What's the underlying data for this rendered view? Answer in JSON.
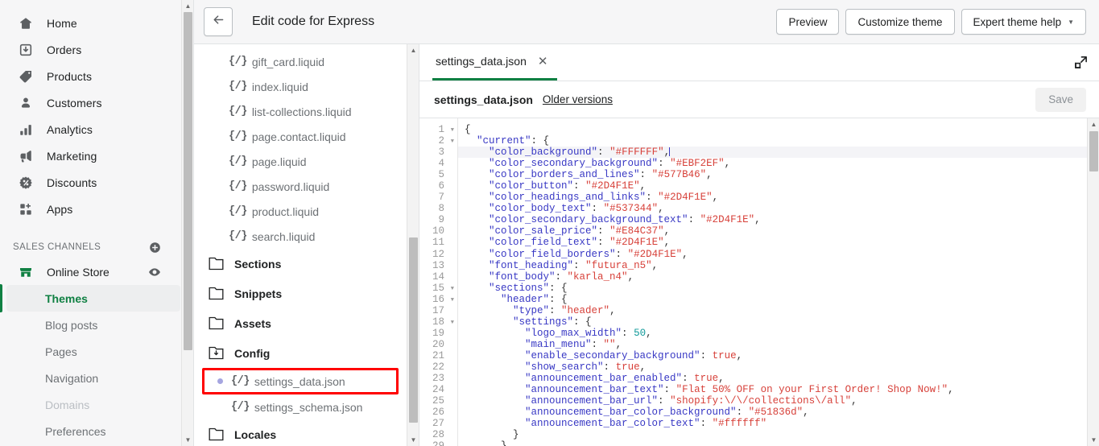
{
  "sidebar": {
    "nav": [
      {
        "label": "Home",
        "icon": "home-icon"
      },
      {
        "label": "Orders",
        "icon": "orders-icon"
      },
      {
        "label": "Products",
        "icon": "products-tag-icon"
      },
      {
        "label": "Customers",
        "icon": "customers-person-icon"
      },
      {
        "label": "Analytics",
        "icon": "analytics-bars-icon"
      },
      {
        "label": "Marketing",
        "icon": "marketing-megaphone-icon"
      },
      {
        "label": "Discounts",
        "icon": "discounts-percent-icon"
      },
      {
        "label": "Apps",
        "icon": "apps-grid-plus-icon"
      }
    ],
    "sales_channels_label": "SALES CHANNELS",
    "add_channel_icon": "plus-circle-icon",
    "online_store": {
      "label": "Online Store",
      "icon": "storefront-icon",
      "preview_icon": "eye-icon"
    },
    "sub_items": [
      {
        "label": "Themes",
        "state": "active"
      },
      {
        "label": "Blog posts",
        "state": "normal"
      },
      {
        "label": "Pages",
        "state": "normal"
      },
      {
        "label": "Navigation",
        "state": "normal"
      },
      {
        "label": "Domains",
        "state": "muted"
      },
      {
        "label": "Preferences",
        "state": "normal"
      }
    ]
  },
  "topbar": {
    "back_icon": "arrow-left-icon",
    "title": "Edit code for Express",
    "preview_label": "Preview",
    "customize_label": "Customize theme",
    "expert_help_label": "Expert theme help",
    "expert_help_caret": "▾"
  },
  "filetree": {
    "files": [
      {
        "name": "gift_card.liquid",
        "icon": "{/}"
      },
      {
        "name": "index.liquid",
        "icon": "{/}"
      },
      {
        "name": "list-collections.liquid",
        "icon": "{/}"
      },
      {
        "name": "page.contact.liquid",
        "icon": "{/}"
      },
      {
        "name": "page.liquid",
        "icon": "{/}"
      },
      {
        "name": "password.liquid",
        "icon": "{/}"
      },
      {
        "name": "product.liquid",
        "icon": "{/}"
      },
      {
        "name": "search.liquid",
        "icon": "{/}"
      }
    ],
    "folders": [
      {
        "name": "Sections",
        "icon": "folder-icon"
      },
      {
        "name": "Snippets",
        "icon": "folder-icon"
      },
      {
        "name": "Assets",
        "icon": "folder-icon"
      },
      {
        "name": "Config",
        "icon": "folder-open-download-icon"
      }
    ],
    "config_files": [
      {
        "name": "settings_data.json",
        "icon": "{/}",
        "highlighted": true,
        "unsaved": true
      },
      {
        "name": "settings_schema.json",
        "icon": "{/}",
        "highlighted": false,
        "unsaved": false
      }
    ],
    "trailing_folder": {
      "name": "Locales",
      "icon": "folder-icon"
    }
  },
  "editor": {
    "tab_label": "settings_data.json",
    "tab_close_icon": "close-icon",
    "expand_icon": "expand-icon",
    "file_name": "settings_data.json",
    "older_versions_label": "Older versions",
    "save_label": "Save",
    "accent_color": "#108043",
    "highlight_color": "#ff0000",
    "active_line": 3,
    "lines": [
      {
        "n": 1,
        "fold": true,
        "tokens": [
          {
            "t": "pun",
            "v": "{"
          }
        ]
      },
      {
        "n": 2,
        "fold": true,
        "tokens": [
          {
            "t": "pun",
            "v": "  "
          },
          {
            "t": "key",
            "v": "\"current\""
          },
          {
            "t": "pun",
            "v": ": {"
          }
        ]
      },
      {
        "n": 3,
        "fold": false,
        "active": true,
        "tokens": [
          {
            "t": "pun",
            "v": "    "
          },
          {
            "t": "key",
            "v": "\"color_background\""
          },
          {
            "t": "pun",
            "v": ": "
          },
          {
            "t": "str",
            "v": "\"#FFFFFF\""
          },
          {
            "t": "pun",
            "v": ","
          },
          {
            "t": "caret",
            "v": ""
          }
        ]
      },
      {
        "n": 4,
        "fold": false,
        "tokens": [
          {
            "t": "pun",
            "v": "    "
          },
          {
            "t": "key",
            "v": "\"color_secondary_background\""
          },
          {
            "t": "pun",
            "v": ": "
          },
          {
            "t": "str",
            "v": "\"#EBF2EF\""
          },
          {
            "t": "pun",
            "v": ","
          }
        ]
      },
      {
        "n": 5,
        "fold": false,
        "tokens": [
          {
            "t": "pun",
            "v": "    "
          },
          {
            "t": "key",
            "v": "\"color_borders_and_lines\""
          },
          {
            "t": "pun",
            "v": ": "
          },
          {
            "t": "str",
            "v": "\"#577B46\""
          },
          {
            "t": "pun",
            "v": ","
          }
        ]
      },
      {
        "n": 6,
        "fold": false,
        "tokens": [
          {
            "t": "pun",
            "v": "    "
          },
          {
            "t": "key",
            "v": "\"color_button\""
          },
          {
            "t": "pun",
            "v": ": "
          },
          {
            "t": "str",
            "v": "\"#2D4F1E\""
          },
          {
            "t": "pun",
            "v": ","
          }
        ]
      },
      {
        "n": 7,
        "fold": false,
        "tokens": [
          {
            "t": "pun",
            "v": "    "
          },
          {
            "t": "key",
            "v": "\"color_headings_and_links\""
          },
          {
            "t": "pun",
            "v": ": "
          },
          {
            "t": "str",
            "v": "\"#2D4F1E\""
          },
          {
            "t": "pun",
            "v": ","
          }
        ]
      },
      {
        "n": 8,
        "fold": false,
        "tokens": [
          {
            "t": "pun",
            "v": "    "
          },
          {
            "t": "key",
            "v": "\"color_body_text\""
          },
          {
            "t": "pun",
            "v": ": "
          },
          {
            "t": "str",
            "v": "\"#537344\""
          },
          {
            "t": "pun",
            "v": ","
          }
        ]
      },
      {
        "n": 9,
        "fold": false,
        "tokens": [
          {
            "t": "pun",
            "v": "    "
          },
          {
            "t": "key",
            "v": "\"color_secondary_background_text\""
          },
          {
            "t": "pun",
            "v": ": "
          },
          {
            "t": "str",
            "v": "\"#2D4F1E\""
          },
          {
            "t": "pun",
            "v": ","
          }
        ]
      },
      {
        "n": 10,
        "fold": false,
        "tokens": [
          {
            "t": "pun",
            "v": "    "
          },
          {
            "t": "key",
            "v": "\"color_sale_price\""
          },
          {
            "t": "pun",
            "v": ": "
          },
          {
            "t": "str",
            "v": "\"#E84C37\""
          },
          {
            "t": "pun",
            "v": ","
          }
        ]
      },
      {
        "n": 11,
        "fold": false,
        "tokens": [
          {
            "t": "pun",
            "v": "    "
          },
          {
            "t": "key",
            "v": "\"color_field_text\""
          },
          {
            "t": "pun",
            "v": ": "
          },
          {
            "t": "str",
            "v": "\"#2D4F1E\""
          },
          {
            "t": "pun",
            "v": ","
          }
        ]
      },
      {
        "n": 12,
        "fold": false,
        "tokens": [
          {
            "t": "pun",
            "v": "    "
          },
          {
            "t": "key",
            "v": "\"color_field_borders\""
          },
          {
            "t": "pun",
            "v": ": "
          },
          {
            "t": "str",
            "v": "\"#2D4F1E\""
          },
          {
            "t": "pun",
            "v": ","
          }
        ]
      },
      {
        "n": 13,
        "fold": false,
        "tokens": [
          {
            "t": "pun",
            "v": "    "
          },
          {
            "t": "key",
            "v": "\"font_heading\""
          },
          {
            "t": "pun",
            "v": ": "
          },
          {
            "t": "str",
            "v": "\"futura_n5\""
          },
          {
            "t": "pun",
            "v": ","
          }
        ]
      },
      {
        "n": 14,
        "fold": false,
        "tokens": [
          {
            "t": "pun",
            "v": "    "
          },
          {
            "t": "key",
            "v": "\"font_body\""
          },
          {
            "t": "pun",
            "v": ": "
          },
          {
            "t": "str",
            "v": "\"karla_n4\""
          },
          {
            "t": "pun",
            "v": ","
          }
        ]
      },
      {
        "n": 15,
        "fold": true,
        "tokens": [
          {
            "t": "pun",
            "v": "    "
          },
          {
            "t": "key",
            "v": "\"sections\""
          },
          {
            "t": "pun",
            "v": ": {"
          }
        ]
      },
      {
        "n": 16,
        "fold": true,
        "tokens": [
          {
            "t": "pun",
            "v": "      "
          },
          {
            "t": "key",
            "v": "\"header\""
          },
          {
            "t": "pun",
            "v": ": {"
          }
        ]
      },
      {
        "n": 17,
        "fold": false,
        "tokens": [
          {
            "t": "pun",
            "v": "        "
          },
          {
            "t": "key",
            "v": "\"type\""
          },
          {
            "t": "pun",
            "v": ": "
          },
          {
            "t": "str",
            "v": "\"header\""
          },
          {
            "t": "pun",
            "v": ","
          }
        ]
      },
      {
        "n": 18,
        "fold": true,
        "tokens": [
          {
            "t": "pun",
            "v": "        "
          },
          {
            "t": "key",
            "v": "\"settings\""
          },
          {
            "t": "pun",
            "v": ": {"
          }
        ]
      },
      {
        "n": 19,
        "fold": false,
        "tokens": [
          {
            "t": "pun",
            "v": "          "
          },
          {
            "t": "key",
            "v": "\"logo_max_width\""
          },
          {
            "t": "pun",
            "v": ": "
          },
          {
            "t": "num",
            "v": "50"
          },
          {
            "t": "pun",
            "v": ","
          }
        ]
      },
      {
        "n": 20,
        "fold": false,
        "tokens": [
          {
            "t": "pun",
            "v": "          "
          },
          {
            "t": "key",
            "v": "\"main_menu\""
          },
          {
            "t": "pun",
            "v": ": "
          },
          {
            "t": "str",
            "v": "\"\""
          },
          {
            "t": "pun",
            "v": ","
          }
        ]
      },
      {
        "n": 21,
        "fold": false,
        "tokens": [
          {
            "t": "pun",
            "v": "          "
          },
          {
            "t": "key",
            "v": "\"enable_secondary_background\""
          },
          {
            "t": "pun",
            "v": ": "
          },
          {
            "t": "bool",
            "v": "true"
          },
          {
            "t": "pun",
            "v": ","
          }
        ]
      },
      {
        "n": 22,
        "fold": false,
        "tokens": [
          {
            "t": "pun",
            "v": "          "
          },
          {
            "t": "key",
            "v": "\"show_search\""
          },
          {
            "t": "pun",
            "v": ": "
          },
          {
            "t": "bool",
            "v": "true"
          },
          {
            "t": "pun",
            "v": ","
          }
        ]
      },
      {
        "n": 23,
        "fold": false,
        "tokens": [
          {
            "t": "pun",
            "v": "          "
          },
          {
            "t": "key",
            "v": "\"announcement_bar_enabled\""
          },
          {
            "t": "pun",
            "v": ": "
          },
          {
            "t": "bool",
            "v": "true"
          },
          {
            "t": "pun",
            "v": ","
          }
        ]
      },
      {
        "n": 24,
        "fold": false,
        "tokens": [
          {
            "t": "pun",
            "v": "          "
          },
          {
            "t": "key",
            "v": "\"announcement_bar_text\""
          },
          {
            "t": "pun",
            "v": ": "
          },
          {
            "t": "str",
            "v": "\"Flat 50% OFF on your First Order! Shop Now!\""
          },
          {
            "t": "pun",
            "v": ","
          }
        ]
      },
      {
        "n": 25,
        "fold": false,
        "tokens": [
          {
            "t": "pun",
            "v": "          "
          },
          {
            "t": "key",
            "v": "\"announcement_bar_url\""
          },
          {
            "t": "pun",
            "v": ": "
          },
          {
            "t": "str",
            "v": "\"shopify:\\/\\/collections\\/all\""
          },
          {
            "t": "pun",
            "v": ","
          }
        ]
      },
      {
        "n": 26,
        "fold": false,
        "tokens": [
          {
            "t": "pun",
            "v": "          "
          },
          {
            "t": "key",
            "v": "\"announcement_bar_color_background\""
          },
          {
            "t": "pun",
            "v": ": "
          },
          {
            "t": "str",
            "v": "\"#51836d\""
          },
          {
            "t": "pun",
            "v": ","
          }
        ]
      },
      {
        "n": 27,
        "fold": false,
        "tokens": [
          {
            "t": "pun",
            "v": "          "
          },
          {
            "t": "key",
            "v": "\"announcement_bar_color_text\""
          },
          {
            "t": "pun",
            "v": ": "
          },
          {
            "t": "str",
            "v": "\"#ffffff\""
          }
        ]
      },
      {
        "n": 28,
        "fold": false,
        "tokens": [
          {
            "t": "pun",
            "v": "        }"
          }
        ]
      },
      {
        "n": 29,
        "fold": false,
        "tokens": [
          {
            "t": "pun",
            "v": "      },"
          }
        ]
      }
    ]
  }
}
